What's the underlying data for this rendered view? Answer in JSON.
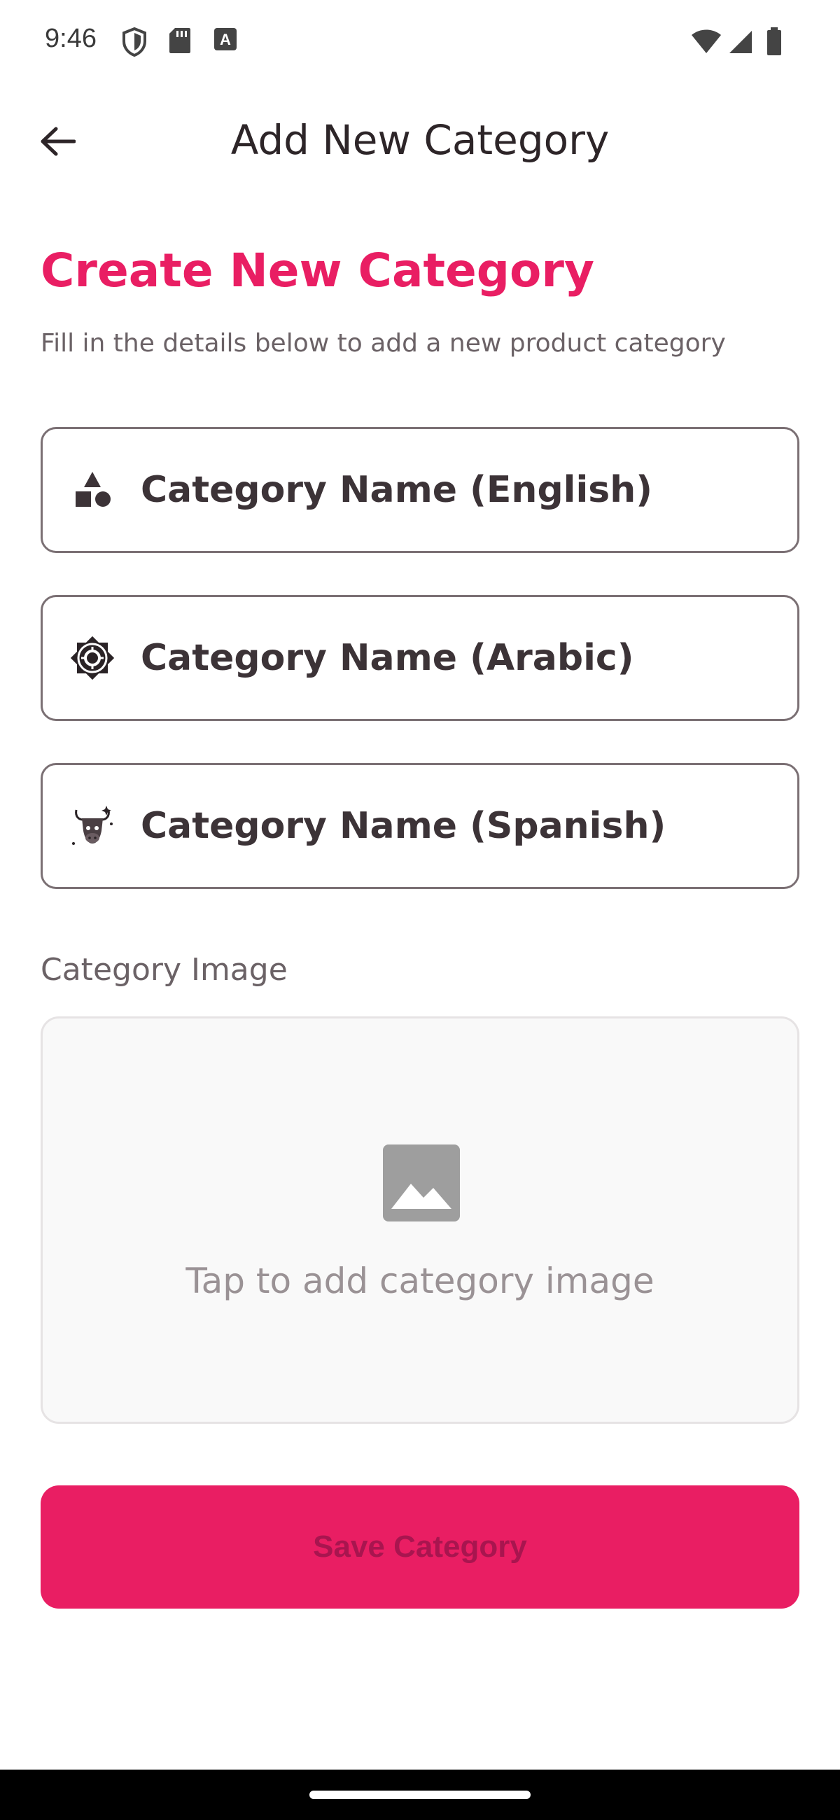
{
  "status_bar": {
    "time": "9:46",
    "icons": [
      "shield-icon",
      "sd-card-icon",
      "font-a-icon",
      "wifi-icon",
      "signal-icon",
      "battery-icon"
    ]
  },
  "app_bar": {
    "title": "Add New Category",
    "back_icon": "back-arrow-icon"
  },
  "form": {
    "heading": "Create New Category",
    "subheading": "Fill in the details below to add a new product category",
    "fields": [
      {
        "label": "Category Name (English)",
        "icon": "shapes-icon"
      },
      {
        "label": "Category Name (Arabic)",
        "icon": "star-octagram-icon"
      },
      {
        "label": "Category Name (Spanish)",
        "icon": "bull-icon"
      }
    ],
    "image_section_label": "Category Image",
    "image_hint": "Tap to add category image",
    "image_icon": "image-placeholder-icon",
    "save_label": "Save Category"
  },
  "colors": {
    "accent": "#e91e63",
    "text_dark": "#3c3337",
    "text_muted": "#6b6266",
    "border": "#7b7074"
  }
}
